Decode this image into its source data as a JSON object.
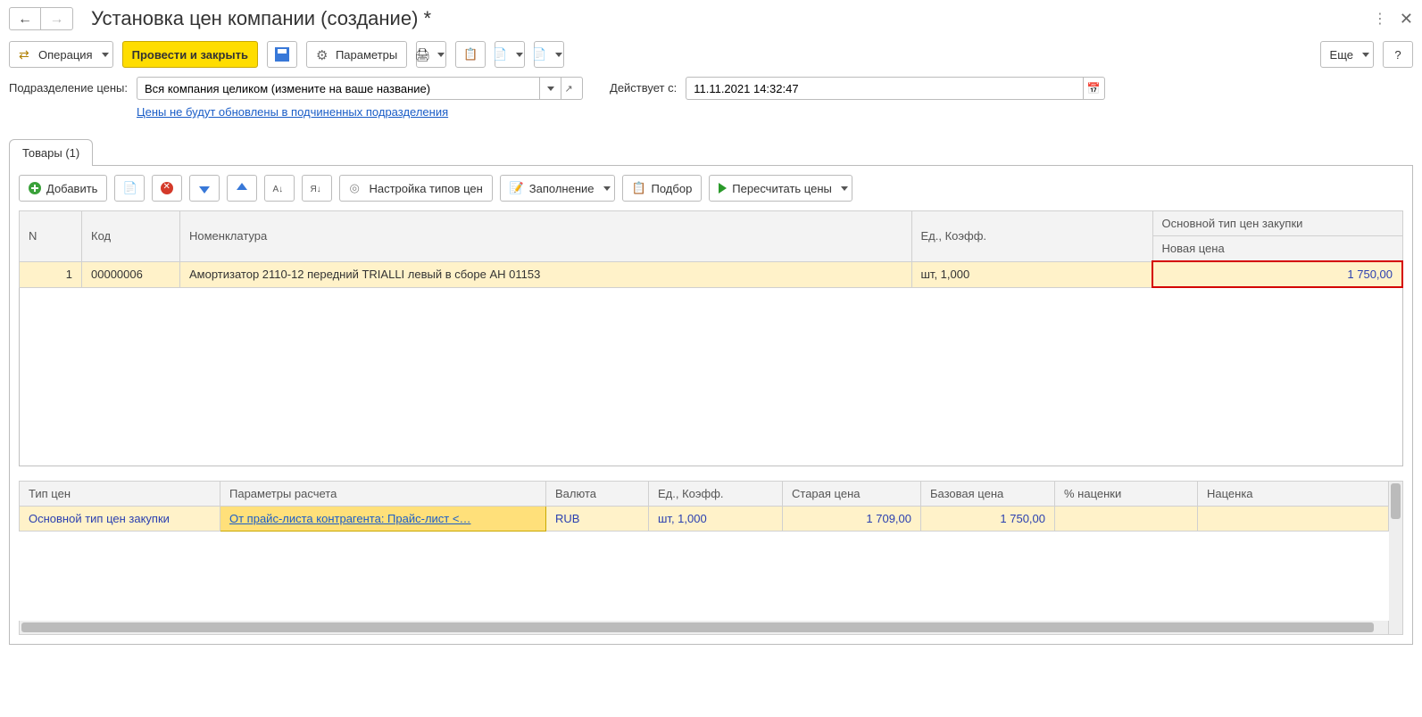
{
  "header": {
    "title": "Установка цен компании (создание) *"
  },
  "toolbar": {
    "operation": "Операция",
    "post_close": "Провести и закрыть",
    "parameters": "Параметры",
    "more": "Еще",
    "help": "?"
  },
  "form": {
    "subdivision_label": "Подразделение цены:",
    "subdivision_value": "Вся компания целиком (измените на ваше название)",
    "note_link": "Цены не будут обновлены в подчиненных подразделения",
    "effective_from_label": "Действует с:",
    "effective_from_value": "11.11.2021 14:32:47"
  },
  "tab": {
    "goods": "Товары (1)"
  },
  "inner_toolbar": {
    "add": "Добавить",
    "price_types": "Настройка типов цен",
    "fill": "Заполнение",
    "pick": "Подбор",
    "recalc": "Пересчитать цены"
  },
  "main_table": {
    "cols": {
      "n": "N",
      "code": "Код",
      "nomenclature": "Номенклатура",
      "unit_coef": "Ед., Коэфф.",
      "price_type": "Основной тип цен закупки",
      "new_price": "Новая цена"
    },
    "rows": [
      {
        "n": "1",
        "code": "00000006",
        "nomenclature": "Амортизатор 2110-12 передний TRIALLI левый в сборе АН 01153",
        "unit_coef": "шт, 1,000",
        "new_price": "1 750,00"
      }
    ]
  },
  "lower_table": {
    "cols": {
      "price_type": "Тип цен",
      "calc_params": "Параметры расчета",
      "currency": "Валюта",
      "unit_coef": "Ед., Коэфф.",
      "old_price": "Старая цена",
      "base_price": "Базовая цена",
      "markup_pct": "% наценки",
      "markup": "Наценка"
    },
    "rows": [
      {
        "price_type": "Основной тип цен закупки",
        "calc_params": "От прайс-листа контрагента: Прайс-лист <…",
        "currency": "RUB",
        "unit_coef": "шт, 1,000",
        "old_price": "1 709,00",
        "base_price": "1 750,00",
        "markup_pct": "",
        "markup": ""
      }
    ]
  }
}
